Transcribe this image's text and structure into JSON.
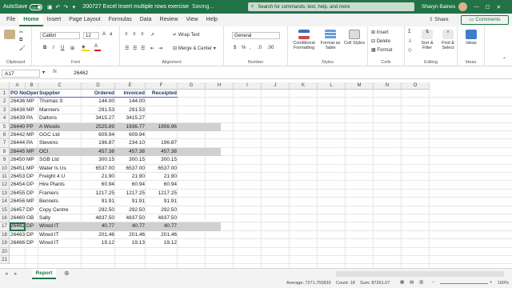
{
  "titlebar": {
    "autosave": "AutoSave",
    "toggle": "On",
    "filename": "200727 Excel Insert multiple rows exercise",
    "saving": "Saving...",
    "search_placeholder": "Search for commands, text, help, and more",
    "user": "Sharyn Baines"
  },
  "tabs": [
    "File",
    "Home",
    "Insert",
    "Page Layout",
    "Formulas",
    "Data",
    "Review",
    "View",
    "Help"
  ],
  "share": "Share",
  "comments": "Comments",
  "ribbon": {
    "clipboard": "Clipboard",
    "font": "Font",
    "font_name": "Calibri",
    "font_size": "12",
    "alignment": "Alignment",
    "wrap_text": "Wrap Text",
    "merge": "Merge & Center",
    "number": "Number",
    "number_format": "General",
    "styles": "Styles",
    "conditional": "Conditional Formatting",
    "format_table": "Format as Table",
    "cell_styles": "Cell Styles",
    "cells": "Cells",
    "insert": "Insert",
    "delete": "Delete",
    "format": "Format",
    "editing": "Editing",
    "sort": "Sort & Filter",
    "find": "Find & Select",
    "ideas_group": "Ideas",
    "ideas": "Ideas"
  },
  "formula_bar": {
    "namebox": "A17",
    "fx": "fx",
    "value": "26462"
  },
  "columns": [
    "A",
    "B",
    "C",
    "D",
    "E",
    "F",
    "G",
    "H",
    "I",
    "J",
    "K",
    "L",
    "M",
    "N",
    "O"
  ],
  "headers": [
    "PO No.",
    "Oper",
    "Supplier",
    "Ordered",
    "Invoiced",
    "Receipted"
  ],
  "rows": [
    [
      "26436",
      "MP",
      "Thomas S",
      "144.00",
      "144.00",
      ""
    ],
    [
      "26438",
      "MP",
      "Manners",
      "291.53",
      "291.53",
      ""
    ],
    [
      "26439",
      "PA",
      "Daltons",
      "3415.27",
      "3415.27",
      ""
    ],
    [
      "26440",
      "PP",
      "A Woods",
      "2525.89",
      "1936.77",
      "1956.96"
    ],
    [
      "26442",
      "MP",
      "GGC Ltd",
      "609.94",
      "609.94",
      ""
    ],
    [
      "26444",
      "PA",
      "Stevens",
      "196.87",
      "234.10",
      "196.87"
    ],
    [
      "26445",
      "MP",
      "OCI",
      "457.38",
      "457.38",
      "457.38"
    ],
    [
      "26450",
      "MP",
      "SGB Ltd",
      "300.15",
      "300.15",
      "300.15"
    ],
    [
      "26451",
      "MP",
      "Water Is Us",
      "6537.00",
      "6537.00",
      "6537.00"
    ],
    [
      "26453",
      "DP",
      "Freight 4 U",
      "21.90",
      "21.90",
      "21.90"
    ],
    [
      "26454",
      "DP",
      "Hire Plants",
      "60.94",
      "60.94",
      "60.94"
    ],
    [
      "26455",
      "DP",
      "Framers",
      "1217.25",
      "1217.25",
      "1217.25"
    ],
    [
      "26456",
      "MP",
      "Bennets",
      "91.91",
      "91.91",
      "91.91"
    ],
    [
      "26457",
      "DP",
      "Copy Centre",
      "292.50",
      "292.50",
      "292.50"
    ],
    [
      "26460",
      "GB",
      "Sally",
      "4837.50",
      "4837.50",
      "4837.50"
    ],
    [
      "26462",
      "DP",
      "Wired IT",
      "40.77",
      "40.77",
      "40.77"
    ],
    [
      "26463",
      "DP",
      "Wired IT",
      "201.46",
      "201.46",
      "201.46"
    ],
    [
      "26466",
      "DP",
      "Wired IT",
      "19.12",
      "19.13",
      "19.12"
    ]
  ],
  "highlight_rows": [
    5,
    8,
    17
  ],
  "row_numbers": [
    "1",
    "2",
    "3",
    "4",
    "5",
    "6",
    "7",
    "8",
    "9",
    "10",
    "11",
    "12",
    "13",
    "14",
    "15",
    "16",
    "17",
    "18",
    "19",
    "20",
    "21"
  ],
  "sheet": {
    "tab": "Report"
  },
  "status": {
    "average": "Average: 7271.755833",
    "count": "Count: 18",
    "sum": "Sum: 87261.07",
    "zoom": "100%"
  }
}
